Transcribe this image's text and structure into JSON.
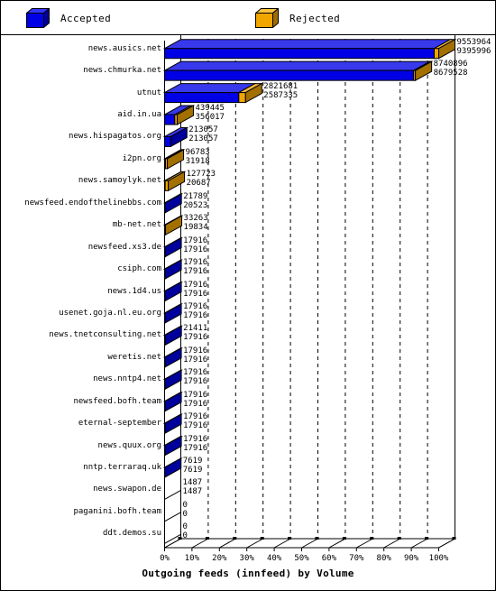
{
  "legend": {
    "items": [
      {
        "key": "accepted",
        "label": "Accepted",
        "color": "#0000e6",
        "side_color": "#00008f",
        "top_color": "#2a2aff",
        "icon": "cube-icon"
      },
      {
        "key": "rejected",
        "label": "Rejected",
        "color": "#f0a500",
        "side_color": "#a06e00",
        "top_color": "#ffc33c",
        "icon": "cube-icon"
      }
    ]
  },
  "chart_data": {
    "type": "bar",
    "orientation": "horizontal",
    "stacked": true,
    "three_d": true,
    "title": "Outgoing feeds (innfeed) by Volume",
    "xlabel": "Outgoing feeds (innfeed) by Volume",
    "ylabel": "",
    "xlim": [
      0,
      100
    ],
    "xunit": "%",
    "grid": true,
    "grid_style": "dashed-vertical",
    "legend_position": "top",
    "max_value": 9553964,
    "xticks": [
      "0%",
      "10%",
      "20%",
      "30%",
      "40%",
      "50%",
      "60%",
      "70%",
      "80%",
      "90%",
      "100%"
    ],
    "xtick_values": [
      0,
      10,
      20,
      30,
      40,
      50,
      60,
      70,
      80,
      90,
      100
    ],
    "categories": [
      "news.ausics.net",
      "news.chmurka.net",
      "utnut",
      "aid.in.ua",
      "news.hispagatos.org",
      "i2pn.org",
      "news.samoylyk.net",
      "newsfeed.endofthelinebbs.com",
      "mb-net.net",
      "newsfeed.xs3.de",
      "csiph.com",
      "news.1d4.us",
      "usenet.goja.nl.eu.org",
      "news.tnetconsulting.net",
      "weretis.net",
      "news.nntp4.net",
      "newsfeed.bofh.team",
      "eternal-september",
      "news.quux.org",
      "nntp.terraraq.uk",
      "news.swapon.de",
      "paganini.bofh.team",
      "ddt.demos.su"
    ],
    "series": [
      {
        "name": "Accepted",
        "color": "#0000e6",
        "values": [
          9395996,
          8679528,
          2587335,
          356017,
          213057,
          31918,
          20687,
          20523,
          19834,
          17916,
          17916,
          17916,
          17916,
          17916,
          17916,
          17916,
          17916,
          17916,
          17916,
          7619,
          1487,
          0,
          0
        ]
      },
      {
        "name": "Rejected",
        "color": "#f0a500",
        "values": [
          157968,
          61368,
          234346,
          83428,
          0,
          64865,
          107036,
          1266,
          13429,
          0,
          0,
          0,
          0,
          3495,
          0,
          0,
          0,
          0,
          0,
          0,
          0,
          0,
          0
        ]
      }
    ],
    "totals": [
      9553964,
      8740896,
      2821681,
      439445,
      213057,
      96783,
      127723,
      21789,
      33263,
      17916,
      17916,
      17916,
      17916,
      21411,
      17916,
      17916,
      17916,
      17916,
      17916,
      7619,
      1487,
      0,
      0
    ],
    "data_labels": [
      {
        "category": "news.ausics.net",
        "total": "9553964",
        "accepted": "9395996"
      },
      {
        "category": "news.chmurka.net",
        "total": "8740896",
        "accepted": "8679528"
      },
      {
        "category": "utnut",
        "total": "2821681",
        "accepted": "2587335"
      },
      {
        "category": "aid.in.ua",
        "total": "439445",
        "accepted": "356017"
      },
      {
        "category": "news.hispagatos.org",
        "total": "213057",
        "accepted": "213057"
      },
      {
        "category": "i2pn.org",
        "total": "96783",
        "accepted": "31918"
      },
      {
        "category": "news.samoylyk.net",
        "total": "127723",
        "accepted": "20687"
      },
      {
        "category": "newsfeed.endofthelinebbs.com",
        "total": "21789",
        "accepted": "20523"
      },
      {
        "category": "mb-net.net",
        "total": "33263",
        "accepted": "19834"
      },
      {
        "category": "newsfeed.xs3.de",
        "total": "17916",
        "accepted": "17916"
      },
      {
        "category": "csiph.com",
        "total": "17916",
        "accepted": "17916"
      },
      {
        "category": "news.1d4.us",
        "total": "17916",
        "accepted": "17916"
      },
      {
        "category": "usenet.goja.nl.eu.org",
        "total": "17916",
        "accepted": "17916"
      },
      {
        "category": "news.tnetconsulting.net",
        "total": "21411",
        "accepted": "17916"
      },
      {
        "category": "weretis.net",
        "total": "17916",
        "accepted": "17916"
      },
      {
        "category": "news.nntp4.net",
        "total": "17916",
        "accepted": "17916"
      },
      {
        "category": "newsfeed.bofh.team",
        "total": "17916",
        "accepted": "17916"
      },
      {
        "category": "eternal-september",
        "total": "17916",
        "accepted": "17916"
      },
      {
        "category": "news.quux.org",
        "total": "17916",
        "accepted": "17916"
      },
      {
        "category": "nntp.terraraq.uk",
        "total": "7619",
        "accepted": "7619"
      },
      {
        "category": "news.swapon.de",
        "total": "1487",
        "accepted": "1487"
      },
      {
        "category": "paganini.bofh.team",
        "total": "0",
        "accepted": "0"
      },
      {
        "category": "ddt.demos.su",
        "total": "0",
        "accepted": "0"
      }
    ]
  }
}
